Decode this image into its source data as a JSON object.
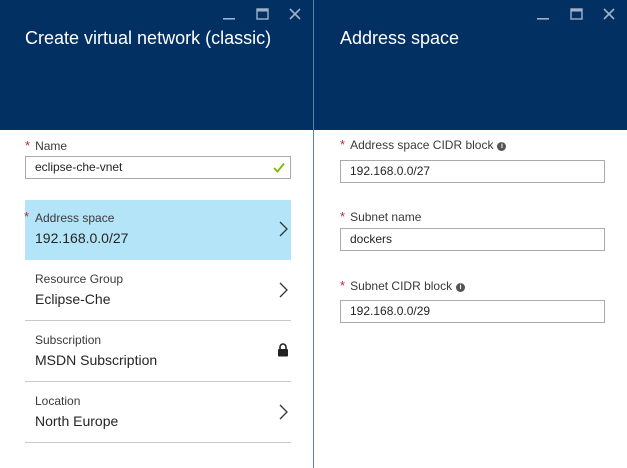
{
  "left_blade": {
    "title": "Create virtual network (classic)",
    "controls": [
      "minimize-icon",
      "maximize-icon",
      "close-icon"
    ],
    "name_field": {
      "label": "Name",
      "required_mark": "*",
      "value": "eclipse-che-vnet",
      "valid_icon": "checkmark-icon"
    },
    "items": [
      {
        "label": "Address space",
        "value": "192.168.0.0/27",
        "required": true,
        "required_mark": "*",
        "icon": "chevron-right-icon",
        "active": true
      },
      {
        "label": "Resource Group",
        "value": "Eclipse-Che",
        "required": false,
        "icon": "chevron-right-icon",
        "active": false
      },
      {
        "label": "Subscription",
        "value": "MSDN Subscription",
        "required": false,
        "icon": "lock-icon",
        "active": false
      },
      {
        "label": "Location",
        "value": "North Europe",
        "required": false,
        "icon": "chevron-right-icon",
        "active": false
      }
    ]
  },
  "right_blade": {
    "title": "Address space",
    "controls": [
      "minimize-icon",
      "maximize-icon",
      "close-icon"
    ],
    "fields": [
      {
        "label": "Address space CIDR block",
        "required_mark": "*",
        "info_icon": true,
        "value": "192.168.0.0/27"
      },
      {
        "label": "Subnet name",
        "required_mark": "*",
        "info_icon": false,
        "value": "dockers"
      },
      {
        "label": "Subnet CIDR block",
        "required_mark": "*",
        "info_icon": true,
        "value": "192.168.0.0/29"
      }
    ]
  },
  "colors": {
    "header_bg": "#033063",
    "active_item_bg": "#b4e4f7",
    "required": "#c4262e",
    "valid_check": "#7fba00"
  }
}
